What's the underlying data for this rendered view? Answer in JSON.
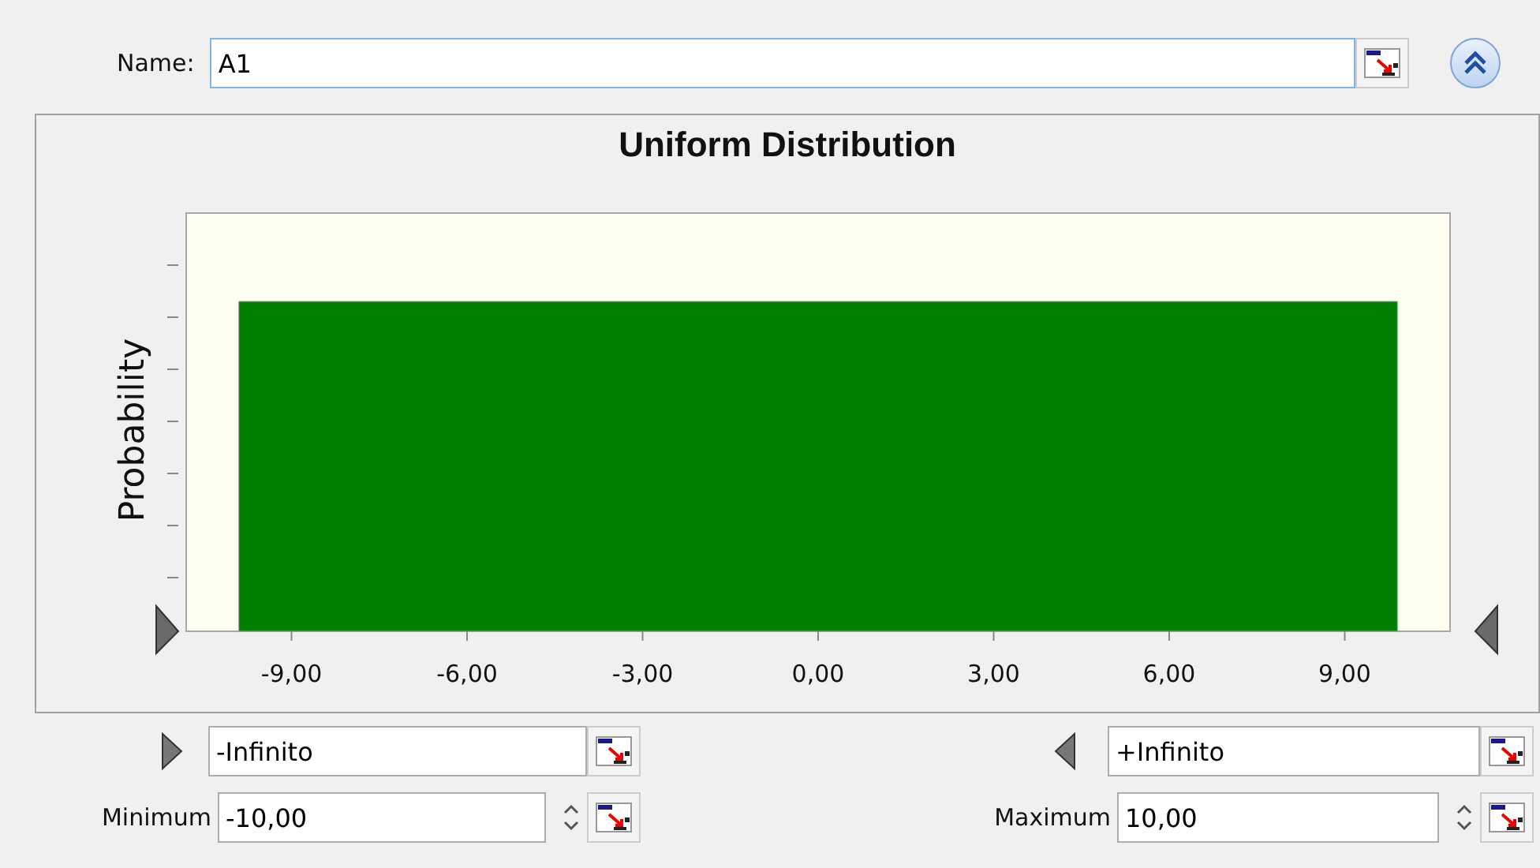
{
  "name_field": {
    "label": "Name:",
    "value": "A1"
  },
  "chart": {
    "title": "Uniform Distribution",
    "ylabel": "Probability",
    "x_axis_labels": [
      "-9,00",
      "-6,00",
      "-3,00",
      "0,00",
      "3,00",
      "6,00",
      "9,00"
    ]
  },
  "lower_bound": {
    "value": "-Infinito"
  },
  "upper_bound": {
    "value": "+Infinito"
  },
  "minimum": {
    "label": "Minimum",
    "value": "-10,00"
  },
  "maximum": {
    "label": "Maximum",
    "value": "10,00"
  }
}
